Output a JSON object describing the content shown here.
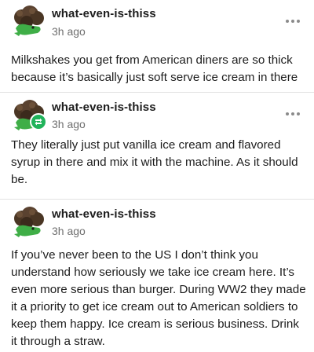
{
  "posts": [
    {
      "username": "what-even-is-thiss",
      "timestamp": "3h ago",
      "text": "Milkshakes you get from American diners are so thick because it’s basically just soft serve ice cream in there",
      "more_icon": "ellipsis-icon",
      "has_badge": false
    },
    {
      "username": "what-even-is-thiss",
      "timestamp": "3h ago",
      "text": "They literally just put vanilla ice cream and flavored syrup in there and mix it with the machine. As it should be.",
      "more_icon": "ellipsis-icon",
      "has_badge": true,
      "badge_icon": "reblog-icon",
      "badge_color": "#20b35a"
    },
    {
      "username": "what-even-is-thiss",
      "timestamp": "3h ago",
      "text": "If you’ve never been to the US I don’t think you understand how seriously we take ice cream here. It’s even more serious than burger. During WW2 they made it a priority to get ice cream out to American soldiers to keep them happy. Ice cream is serious business. Drink it through a straw.",
      "has_badge": false
    }
  ],
  "colors": {
    "text": "#1c1c1c",
    "muted": "#6f6f6f",
    "separator": "#e2e2e2",
    "avatar_green": "#3fae47",
    "avatar_hair": "#4a3624"
  }
}
